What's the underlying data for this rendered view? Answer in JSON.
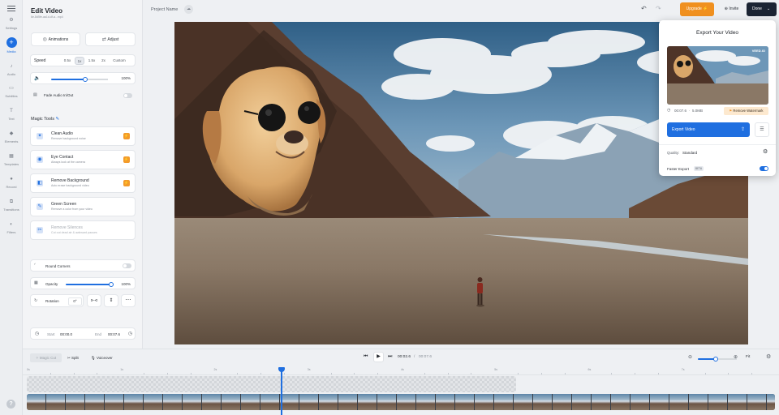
{
  "rail": {
    "menu_icon": "menu-icon",
    "items": [
      {
        "label": "Settings",
        "icon": "gear-icon"
      },
      {
        "label": "Media",
        "icon": "plus-icon",
        "active": true
      },
      {
        "label": "Audio",
        "icon": "music-icon"
      },
      {
        "label": "Subtitles",
        "icon": "subtitles-icon"
      },
      {
        "label": "Text",
        "icon": "text-icon"
      },
      {
        "label": "Elements",
        "icon": "shapes-icon"
      },
      {
        "label": "Templates",
        "icon": "templates-icon"
      },
      {
        "label": "Record",
        "icon": "record-icon"
      },
      {
        "label": "Transitions",
        "icon": "transitions-icon"
      },
      {
        "label": "Filters",
        "icon": "filters-icon"
      }
    ],
    "help_icon": "help-icon"
  },
  "panel": {
    "title": "Edit Video",
    "filename": "6e-8d5fe-aa1d-df-a...mp4",
    "animations_label": "Animations",
    "adjust_label": "Adjust",
    "speed_label": "Speed",
    "speed_options": [
      "0.5x",
      "1x",
      "1.5x",
      "2x",
      "Custom"
    ],
    "speed_selected": "1x",
    "volume_value": "100%",
    "volume_level": 0.6,
    "fade_label": "Fade Audio In/Out",
    "fade_on": false,
    "magic_tools_label": "Magic Tools",
    "tools": [
      {
        "title": "Clean Audio",
        "desc": "Remove background noise",
        "icon": "sparkle-icon",
        "badge": true,
        "enabled": true
      },
      {
        "title": "Eye Contact",
        "desc": "Always look at the camera",
        "icon": "eye-icon",
        "badge": true,
        "enabled": true
      },
      {
        "title": "Remove Background",
        "desc": "Auto erase background video",
        "icon": "erase-icon",
        "badge": true,
        "enabled": true
      },
      {
        "title": "Green Screen",
        "desc": "Remove a color from your video",
        "icon": "pen-icon",
        "badge": false,
        "enabled": true
      },
      {
        "title": "Remove Silences",
        "desc": "Cut out dead air & awkward pauses",
        "icon": "scissors-icon",
        "badge": false,
        "enabled": false
      }
    ],
    "round_corners_label": "Round Corners",
    "round_corners_on": false,
    "opacity_label": "Opacity",
    "opacity_value": "100%",
    "opacity_level": 1.0,
    "rotation_label": "Rotation",
    "rotation_value": "0°",
    "start_label": "Start",
    "start_value": "00:00.0",
    "end_label": "End",
    "end_value": "00:07.6"
  },
  "topbar": {
    "project_name": "Project Name",
    "upgrade_label": "Upgrade",
    "invite_label": "Invite",
    "done_label": "Done",
    "accent": "#f0901f",
    "dark": "#1b2433"
  },
  "export": {
    "title": "Export Your Video",
    "thumb_brand": "VEED.IO",
    "duration": "00:07.6",
    "size": "5.0MB",
    "remove_watermark_label": "Remove Watermark",
    "export_button_label": "Export Video",
    "quality_label": "Quality:",
    "quality_value": "Standard",
    "faster_label": "Faster Export",
    "faster_badge": "BETA",
    "faster_on": true,
    "blue": "#1f6fe0"
  },
  "timeline": {
    "magic_cut_label": "Magic Cut",
    "split_label": "Split",
    "voiceover_label": "Voiceover",
    "current_time": "00:02.6",
    "total_time": "00:07.6",
    "zoom_level": 0.45,
    "fit_label": "Fit",
    "ruler": [
      "0s",
      "1s",
      "2s",
      "3s",
      "4s",
      "5s",
      "6s",
      "7s"
    ],
    "playhead_fraction": 0.34
  }
}
